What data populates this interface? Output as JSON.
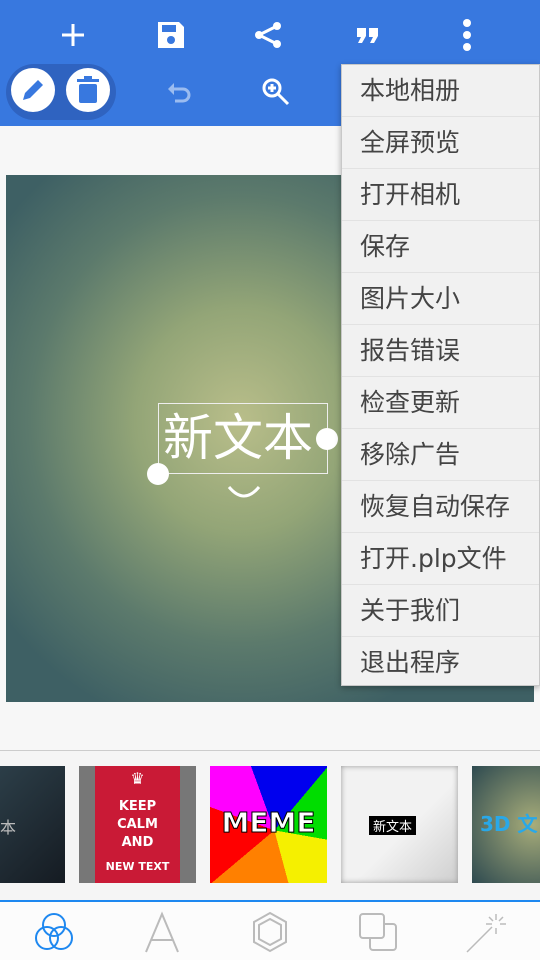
{
  "toolbar": {
    "top_icons": [
      "plus-icon",
      "save-icon",
      "share-icon",
      "quote-icon",
      "more-vert-icon"
    ],
    "second_row_icons": [
      "pencil-icon",
      "trash-icon",
      "undo-icon",
      "zoom-in-icon"
    ]
  },
  "canvas": {
    "text": "新文本"
  },
  "menu": {
    "items": [
      "本地相册",
      "全屏预览",
      "打开相机",
      "保存",
      "图片大小",
      "报告错误",
      "检查更新",
      "移除广告",
      "恢复自动保存",
      "打开.plp文件",
      "关于我们",
      "退出程序"
    ]
  },
  "templates": [
    {
      "text": "本"
    },
    {
      "lines": [
        "KEEP",
        "CALM",
        "AND",
        "NEW TEXT"
      ]
    },
    {
      "text": "MEME"
    },
    {
      "text": "新文本"
    },
    {
      "text": "3D 文"
    }
  ],
  "bottom_nav": {
    "items": [
      "filters-icon",
      "text-icon",
      "shape-icon",
      "layers-icon",
      "magic-wand-icon"
    ],
    "active": 0,
    "active_color": "#1e88f0"
  },
  "colors": {
    "primary": "#3878df"
  }
}
